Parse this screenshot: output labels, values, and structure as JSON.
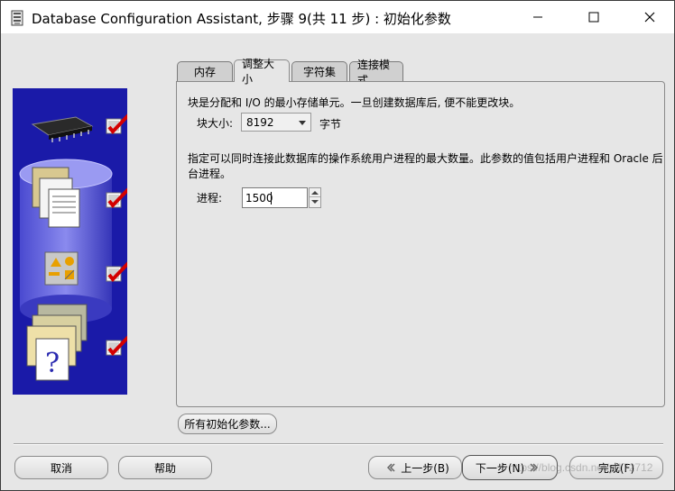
{
  "window": {
    "title": "Database Configuration Assistant, 步骤 9(共 11 步) : 初始化参数"
  },
  "tabs": [
    {
      "label": "内存",
      "active": false
    },
    {
      "label": "调整大小",
      "active": true
    },
    {
      "label": "字符集",
      "active": false
    },
    {
      "label": "连接模式",
      "active": false
    }
  ],
  "sizing": {
    "block_desc": "块是分配和 I/O 的最小存储单元。一旦创建数据库后, 便不能更改块。",
    "block_size_label": "块大小:",
    "block_size_value": "8192",
    "block_size_unit": "字节",
    "proc_desc_line1": "指定可以同时连接此数据库的操作系统用户进程的最大数量。此参数的值包括用户进程和 Oracle 后",
    "proc_desc_line2": "台进程。",
    "processes_label": "进程:",
    "processes_value": "1500"
  },
  "buttons": {
    "all_params": "所有初始化参数...",
    "cancel": "取消",
    "help": "帮助",
    "back": "上一步(B)",
    "next": "下一步(N)",
    "finish": "完成(F)"
  },
  "watermark": "https://blog.csdn.net/yl172712",
  "colors": {
    "side_panel_bg": "#1a1aa8",
    "check_red": "#d40000"
  },
  "icons": {
    "side_steps": [
      "chip-icon",
      "documents-icon",
      "shapes-icon",
      "help-folder-icon"
    ]
  }
}
